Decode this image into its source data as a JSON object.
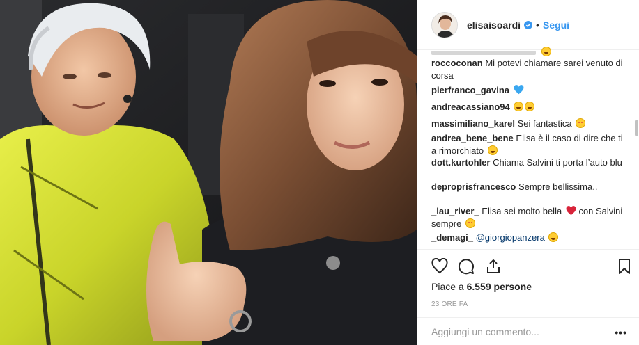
{
  "post": {
    "username": "elisaisoardi",
    "verified_icon": "verified-badge-icon",
    "separator": "•",
    "follow_label": "Segui",
    "avatar": "profile-avatar"
  },
  "comments": [
    {
      "user": "roccoconan",
      "text": "Mi potevi chiamare sarei venuto di corsa",
      "emoji": ""
    },
    {
      "user": "pierfranco_gavina",
      "text": "",
      "emoji": "blue-heart"
    },
    {
      "user": "andreacassiano94",
      "text": "",
      "emoji": "laughing-laughing"
    },
    {
      "user": "massimiliano_karel",
      "text": "Sei fantastica",
      "emoji": "smiling-hearts"
    },
    {
      "user": "andrea_bene_bene",
      "text": "Elisa è il caso di dire che ti a rimorchiato",
      "emoji": "rolling-laughing"
    },
    {
      "user": "dott.kurtohler",
      "text": "Chiama Salvini ti porta l’auto blu",
      "emoji": ""
    },
    {
      "user": "deproprisfrancesco",
      "text": "Sempre bellissima..",
      "emoji": ""
    },
    {
      "user": "_lau_river_",
      "text_a": "Elisa sei molto bella",
      "text_b": "con Salvini sempre",
      "emoji": "red-heart, smiling-hearts"
    },
    {
      "user": "_demagi_",
      "mention": "@giorgiopanzera",
      "emoji": "laughing"
    }
  ],
  "actions": {
    "like_icon": "heart-icon",
    "comment_icon": "comment-icon",
    "share_icon": "share-icon",
    "save_icon": "bookmark-icon"
  },
  "likes": {
    "prefix": "Piace a",
    "count": "6.559",
    "suffix": "persone"
  },
  "timestamp": "23 ORE FA",
  "comment_input": {
    "placeholder": "Aggiungi un commento...",
    "more": "•••"
  },
  "colors": {
    "link": "#3897f0",
    "text": "#262626",
    "muted": "#999999",
    "border": "#efefef"
  }
}
